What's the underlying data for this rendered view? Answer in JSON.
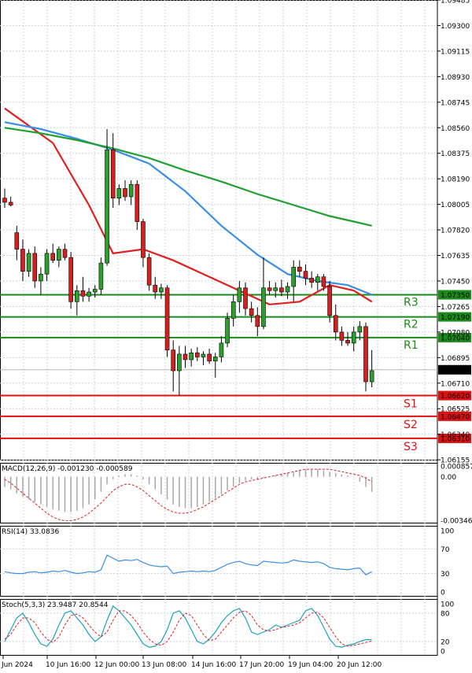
{
  "chart_data": {
    "type": "candlestick",
    "price_axis": {
      "min": 1.0615,
      "max": 1.09485,
      "tick_labels": [
        "1.09485",
        "1.09300",
        "1.09115",
        "1.08930",
        "1.08745",
        "1.08560",
        "1.08375",
        "1.08190",
        "1.08005",
        "1.07820",
        "1.07635",
        "1.07450",
        "1.07265",
        "1.07080",
        "1.06895",
        "1.06710",
        "1.06525",
        "1.06340",
        "1.06155"
      ]
    },
    "time_labels": [
      "Jun 2024",
      "10 Jun 16:00",
      "12 Jun 00:00",
      "13 Jun 08:00",
      "14 Jun 16:00",
      "17 Jun 20:00",
      "19 Jun 04:00",
      "20 Jun 12:00"
    ],
    "candles": [
      {
        "o": 1.0805,
        "h": 1.0812,
        "l": 1.0798,
        "c": 1.0802
      },
      {
        "o": 1.0802,
        "h": 1.0806,
        "l": 1.0799,
        "c": 1.08
      },
      {
        "o": 1.078,
        "h": 1.0785,
        "l": 1.076,
        "c": 1.0768
      },
      {
        "o": 1.0768,
        "h": 1.0775,
        "l": 1.0745,
        "c": 1.0752
      },
      {
        "o": 1.0752,
        "h": 1.0768,
        "l": 1.0748,
        "c": 1.0765
      },
      {
        "o": 1.0765,
        "h": 1.077,
        "l": 1.074,
        "c": 1.0745
      },
      {
        "o": 1.0745,
        "h": 1.0755,
        "l": 1.0735,
        "c": 1.075
      },
      {
        "o": 1.075,
        "h": 1.0768,
        "l": 1.0745,
        "c": 1.0765
      },
      {
        "o": 1.0765,
        "h": 1.0772,
        "l": 1.0758,
        "c": 1.076
      },
      {
        "o": 1.076,
        "h": 1.077,
        "l": 1.0755,
        "c": 1.0768
      },
      {
        "o": 1.0768,
        "h": 1.0772,
        "l": 1.076,
        "c": 1.0762
      },
      {
        "o": 1.0762,
        "h": 1.0766,
        "l": 1.0725,
        "c": 1.073
      },
      {
        "o": 1.073,
        "h": 1.0742,
        "l": 1.072,
        "c": 1.0738
      },
      {
        "o": 1.0738,
        "h": 1.0748,
        "l": 1.073,
        "c": 1.0734
      },
      {
        "o": 1.0734,
        "h": 1.074,
        "l": 1.073,
        "c": 1.0737
      },
      {
        "o": 1.0737,
        "h": 1.0742,
        "l": 1.0733,
        "c": 1.0739
      },
      {
        "o": 1.0739,
        "h": 1.0762,
        "l": 1.0735,
        "c": 1.0758
      },
      {
        "o": 1.0758,
        "h": 1.0855,
        "l": 1.0756,
        "c": 1.084
      },
      {
        "o": 1.084,
        "h": 1.0852,
        "l": 1.0798,
        "c": 1.0805
      },
      {
        "o": 1.0805,
        "h": 1.0815,
        "l": 1.08,
        "c": 1.0812
      },
      {
        "o": 1.0812,
        "h": 1.0818,
        "l": 1.0803,
        "c": 1.0806
      },
      {
        "o": 1.0806,
        "h": 1.0818,
        "l": 1.08,
        "c": 1.0815
      },
      {
        "o": 1.0815,
        "h": 1.0818,
        "l": 1.0782,
        "c": 1.0788
      },
      {
        "o": 1.0788,
        "h": 1.079,
        "l": 1.0755,
        "c": 1.0762
      },
      {
        "o": 1.0762,
        "h": 1.0765,
        "l": 1.0738,
        "c": 1.0742
      },
      {
        "o": 1.0742,
        "h": 1.0748,
        "l": 1.0732,
        "c": 1.0737
      },
      {
        "o": 1.0737,
        "h": 1.0743,
        "l": 1.0732,
        "c": 1.074
      },
      {
        "o": 1.074,
        "h": 1.0742,
        "l": 1.069,
        "c": 1.0695
      },
      {
        "o": 1.0695,
        "h": 1.0702,
        "l": 1.0665,
        "c": 1.068
      },
      {
        "o": 1.068,
        "h": 1.0698,
        "l": 1.0662,
        "c": 1.0692
      },
      {
        "o": 1.0692,
        "h": 1.0698,
        "l": 1.0682,
        "c": 1.0688
      },
      {
        "o": 1.0688,
        "h": 1.0696,
        "l": 1.0683,
        "c": 1.0693
      },
      {
        "o": 1.0693,
        "h": 1.0697,
        "l": 1.0687,
        "c": 1.069
      },
      {
        "o": 1.069,
        "h": 1.0694,
        "l": 1.0684,
        "c": 1.0692
      },
      {
        "o": 1.0692,
        "h": 1.0696,
        "l": 1.0685,
        "c": 1.0687
      },
      {
        "o": 1.0687,
        "h": 1.0693,
        "l": 1.0675,
        "c": 1.069
      },
      {
        "o": 1.069,
        "h": 1.0705,
        "l": 1.0686,
        "c": 1.07
      },
      {
        "o": 1.07,
        "h": 1.0722,
        "l": 1.0697,
        "c": 1.0718
      },
      {
        "o": 1.0718,
        "h": 1.0735,
        "l": 1.0712,
        "c": 1.073
      },
      {
        "o": 1.073,
        "h": 1.0745,
        "l": 1.0722,
        "c": 1.074
      },
      {
        "o": 1.074,
        "h": 1.0744,
        "l": 1.072,
        "c": 1.0725
      },
      {
        "o": 1.0725,
        "h": 1.073,
        "l": 1.0715,
        "c": 1.072
      },
      {
        "o": 1.072,
        "h": 1.0726,
        "l": 1.0705,
        "c": 1.0712
      },
      {
        "o": 1.0712,
        "h": 1.0762,
        "l": 1.071,
        "c": 1.074
      },
      {
        "o": 1.074,
        "h": 1.0745,
        "l": 1.0735,
        "c": 1.0738
      },
      {
        "o": 1.0738,
        "h": 1.0744,
        "l": 1.0733,
        "c": 1.074
      },
      {
        "o": 1.074,
        "h": 1.0746,
        "l": 1.0734,
        "c": 1.0737
      },
      {
        "o": 1.0737,
        "h": 1.0744,
        "l": 1.0732,
        "c": 1.0741
      },
      {
        "o": 1.0741,
        "h": 1.076,
        "l": 1.073,
        "c": 1.0755
      },
      {
        "o": 1.0755,
        "h": 1.076,
        "l": 1.0748,
        "c": 1.0752
      },
      {
        "o": 1.0752,
        "h": 1.0757,
        "l": 1.0742,
        "c": 1.0747
      },
      {
        "o": 1.0747,
        "h": 1.0752,
        "l": 1.074,
        "c": 1.0744
      },
      {
        "o": 1.0744,
        "h": 1.075,
        "l": 1.0738,
        "c": 1.0748
      },
      {
        "o": 1.0748,
        "h": 1.075,
        "l": 1.0738,
        "c": 1.0741
      },
      {
        "o": 1.0741,
        "h": 1.0745,
        "l": 1.0715,
        "c": 1.072
      },
      {
        "o": 1.072,
        "h": 1.0728,
        "l": 1.0702,
        "c": 1.0708
      },
      {
        "o": 1.0708,
        "h": 1.0712,
        "l": 1.0698,
        "c": 1.0702
      },
      {
        "o": 1.0702,
        "h": 1.0708,
        "l": 1.0698,
        "c": 1.07
      },
      {
        "o": 1.07,
        "h": 1.0712,
        "l": 1.0694,
        "c": 1.0708
      },
      {
        "o": 1.0708,
        "h": 1.0716,
        "l": 1.0702,
        "c": 1.0712
      },
      {
        "o": 1.0712,
        "h": 1.0715,
        "l": 1.0665,
        "c": 1.0672
      },
      {
        "o": 1.0672,
        "h": 1.0695,
        "l": 1.0668,
        "c": 1.068
      }
    ],
    "moving_averages": [
      {
        "color": "#e02020",
        "points": [
          [
            0,
            1.087
          ],
          [
            8,
            1.0845
          ],
          [
            14,
            1.08
          ],
          [
            18,
            1.0765
          ],
          [
            23,
            1.0768
          ],
          [
            28,
            1.076
          ],
          [
            34,
            1.0748
          ],
          [
            39,
            1.0738
          ],
          [
            44,
            1.0728
          ],
          [
            49,
            1.073
          ],
          [
            54,
            1.0742
          ],
          [
            58,
            1.0738
          ],
          [
            61,
            1.073
          ]
        ]
      },
      {
        "color": "#3a8ee6",
        "points": [
          [
            0,
            1.086
          ],
          [
            6,
            1.0855
          ],
          [
            12,
            1.0848
          ],
          [
            18,
            1.084
          ],
          [
            24,
            1.083
          ],
          [
            30,
            1.081
          ],
          [
            36,
            1.0785
          ],
          [
            42,
            1.0764
          ],
          [
            47,
            1.075
          ],
          [
            52,
            1.0745
          ],
          [
            57,
            1.0742
          ],
          [
            61,
            1.0735
          ]
        ]
      },
      {
        "color": "#20a030",
        "points": [
          [
            0,
            1.0856
          ],
          [
            6,
            1.0852
          ],
          [
            12,
            1.0847
          ],
          [
            18,
            1.0841
          ],
          [
            24,
            1.0834
          ],
          [
            30,
            1.0825
          ],
          [
            36,
            1.0817
          ],
          [
            42,
            1.0808
          ],
          [
            48,
            1.08
          ],
          [
            54,
            1.0792
          ],
          [
            58,
            1.0788
          ],
          [
            61,
            1.0785
          ]
        ]
      }
    ],
    "levels": [
      {
        "name": "R3",
        "value": 1.0735,
        "label": "1.07350",
        "color": "#1a8a1a"
      },
      {
        "name": "R2",
        "value": 1.0719,
        "label": "1.07190",
        "color": "#1a8a1a"
      },
      {
        "name": "R1",
        "value": 1.0704,
        "label": "1.07040",
        "color": "#1a8a1a"
      },
      {
        "name": "S1",
        "value": 1.0662,
        "label": "1.06620",
        "color": "#dd1111"
      },
      {
        "name": "S2",
        "value": 1.0647,
        "label": "1.06470",
        "color": "#dd1111"
      },
      {
        "name": "S3",
        "value": 1.0631,
        "label": "1.06310",
        "color": "#dd1111"
      }
    ],
    "current_price": "1.06807",
    "macd": {
      "title": "MACD(12,26,9) -0.001230 -0.000589",
      "axis_labels": [
        "0.000857",
        "0.00",
        "-0.003462"
      ],
      "min": -0.003462,
      "max": 0.000857,
      "histogram": [
        -0.0008,
        -0.001,
        -0.0013,
        -0.0016,
        -0.0018,
        -0.002,
        -0.0022,
        -0.0024,
        -0.0026,
        -0.0027,
        -0.0028,
        -0.0028,
        -0.0027,
        -0.0025,
        -0.0022,
        -0.0018,
        -0.0012,
        -0.0006,
        -0.0002,
        0.0001,
        0.0002,
        0.0002,
        0.0001,
        -0.0002,
        -0.0006,
        -0.001,
        -0.0014,
        -0.0018,
        -0.0022,
        -0.0024,
        -0.0025,
        -0.0025,
        -0.0024,
        -0.0022,
        -0.002,
        -0.0017,
        -0.0014,
        -0.0011,
        -0.0008,
        -0.0005,
        -0.0003,
        -0.0002,
        -0.0002,
        -0.0001,
        0.0,
        0.0001,
        0.0002,
        0.0003,
        0.0004,
        0.0005,
        0.0006,
        0.0006,
        0.0006,
        0.0005,
        0.0004,
        0.0003,
        0.0002,
        0.0001,
        0.0,
        -0.0004,
        -0.0008,
        -0.0012
      ],
      "signal": [
        -0.0002,
        -0.0005,
        -0.0009,
        -0.0013,
        -0.0017,
        -0.0021,
        -0.0025,
        -0.0029,
        -0.0032,
        -0.0034,
        -0.0035,
        -0.0035,
        -0.0034,
        -0.0032,
        -0.0029,
        -0.0025,
        -0.0021,
        -0.0016,
        -0.0011,
        -0.0008,
        -0.0006,
        -0.0006,
        -0.0008,
        -0.0011,
        -0.0015,
        -0.0019,
        -0.0023,
        -0.0026,
        -0.0028,
        -0.0029,
        -0.0029,
        -0.0028,
        -0.0026,
        -0.0024,
        -0.0021,
        -0.0018,
        -0.0015,
        -0.0012,
        -0.0009,
        -0.0006,
        -0.0004,
        -0.0003,
        -0.0002,
        -0.0001,
        0.0,
        0.0001,
        0.0002,
        0.0003,
        0.0004,
        0.0005,
        0.0006,
        0.0006,
        0.0006,
        0.0006,
        0.0006,
        0.0005,
        0.0004,
        0.0003,
        0.0002,
        0.0001,
        -0.0001,
        -0.0004
      ]
    },
    "rsi": {
      "title": "RSI(14) 33.0836",
      "axis_labels": [
        "100",
        "70",
        "30",
        "0"
      ],
      "values": [
        33,
        31,
        30,
        30,
        32,
        33,
        31,
        32,
        34,
        33,
        35,
        32,
        30,
        31,
        33,
        32,
        36,
        60,
        55,
        50,
        52,
        51,
        53,
        48,
        44,
        42,
        41,
        42,
        30,
        32,
        33,
        34,
        33,
        34,
        33,
        35,
        40,
        45,
        48,
        50,
        46,
        44,
        43,
        50,
        49,
        48,
        47,
        48,
        52,
        50,
        49,
        48,
        49,
        46,
        40,
        38,
        37,
        36,
        38,
        39,
        28,
        33
      ]
    },
    "stoch": {
      "title": "Stoch(5,3,3) 23.9487 20.8544",
      "axis_labels": [
        "100",
        "80",
        "20",
        "0"
      ],
      "k": [
        20,
        45,
        70,
        80,
        60,
        35,
        15,
        10,
        25,
        55,
        80,
        85,
        70,
        55,
        35,
        20,
        30,
        65,
        95,
        85,
        70,
        55,
        35,
        15,
        8,
        10,
        20,
        45,
        80,
        85,
        70,
        45,
        20,
        15,
        25,
        40,
        60,
        75,
        85,
        90,
        70,
        40,
        35,
        40,
        45,
        55,
        50,
        55,
        60,
        65,
        85,
        90,
        75,
        50,
        25,
        10,
        8,
        12,
        15,
        20,
        24,
        24
      ],
      "d": [
        25,
        35,
        55,
        70,
        70,
        60,
        40,
        25,
        18,
        30,
        55,
        75,
        78,
        70,
        55,
        40,
        30,
        40,
        65,
        85,
        85,
        75,
        60,
        40,
        25,
        15,
        12,
        20,
        40,
        65,
        80,
        75,
        55,
        35,
        22,
        25,
        40,
        55,
        70,
        82,
        85,
        75,
        55,
        45,
        42,
        45,
        50,
        52,
        55,
        60,
        70,
        80,
        82,
        70,
        50,
        30,
        15,
        10,
        12,
        15,
        18,
        21
      ]
    }
  }
}
